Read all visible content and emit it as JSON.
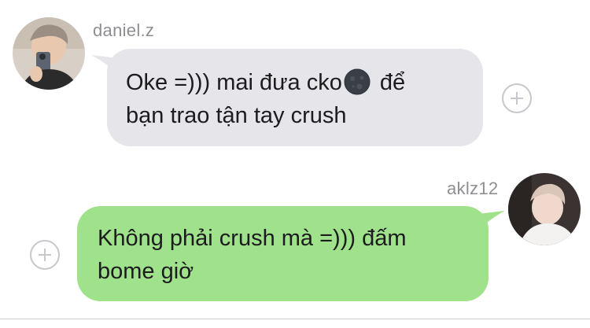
{
  "messages": [
    {
      "sender": "daniel.z",
      "side": "left",
      "lines": [
        "Oke =))) mai đưa cko",
        "để",
        "bạn trao tận tay crush"
      ],
      "emoji": "new-moon-face-icon",
      "bubble_color": "#e5e5ea"
    },
    {
      "sender": "aklz12",
      "side": "right",
      "lines": [
        "Không phải crush mà =))) đấm",
        "bome giờ"
      ],
      "bubble_color": "#9fe28b"
    }
  ],
  "icons": {
    "react_left_message": "add-reaction-icon",
    "react_right_message": "add-reaction-icon"
  },
  "colors": {
    "incoming_bubble": "#e5e5ea",
    "outgoing_bubble": "#9fe28b",
    "username_text": "#8e8e93",
    "background": "#ffffff"
  }
}
